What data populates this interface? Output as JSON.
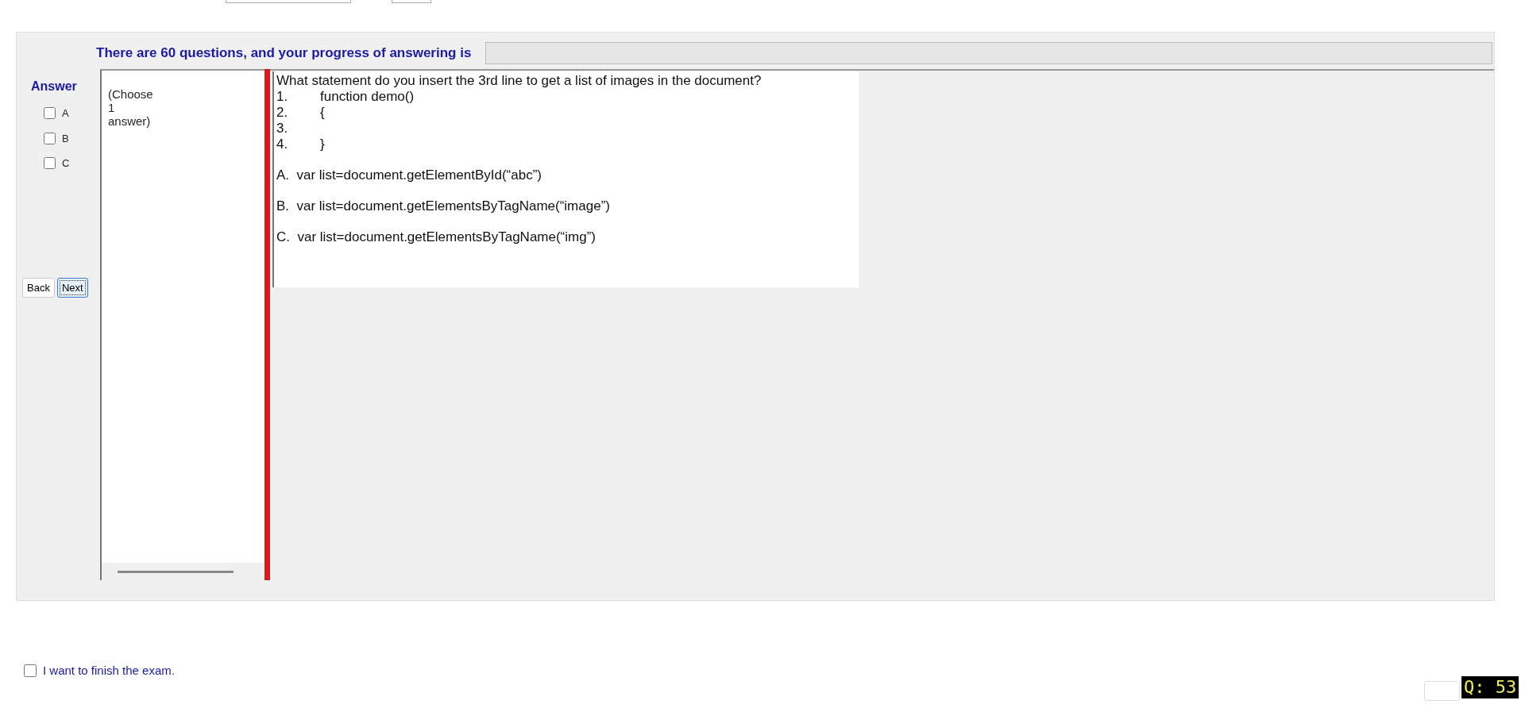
{
  "progress": {
    "label": "There are 60 questions, and your progress of answering is",
    "level": 0
  },
  "answer": {
    "title": "Answer",
    "options": [
      {
        "label": "A",
        "checked": false
      },
      {
        "label": "B",
        "checked": false
      },
      {
        "label": "C",
        "checked": false
      }
    ]
  },
  "nav_buttons": [
    {
      "label": "Back",
      "focused": false
    },
    {
      "label": "Next",
      "focused": true
    }
  ],
  "instruction": "(Choose\n1\nanswer)",
  "question": {
    "prompt": "What statement do you insert the 3rd line to get a list of images in the document?",
    "code_lines": [
      {
        "number": "1.",
        "code": "function demo()"
      },
      {
        "number": "2.",
        "code": "{"
      },
      {
        "number": "3."
      },
      {
        "number": "4.",
        "code": "}"
      }
    ],
    "choices": [
      {
        "letter": "A.",
        "text": "var list=document.getElementById(“abc”)"
      },
      {
        "letter": "B.",
        "text": "var list=document.getElementsByTagName(“image”)"
      },
      {
        "letter": "C.",
        "text": "var list=document.getElementsByTagName(“img”)"
      }
    ]
  },
  "finish": {
    "label": "I want to finish the exam.",
    "checked": false
  },
  "question_counter": "Q: 53"
}
